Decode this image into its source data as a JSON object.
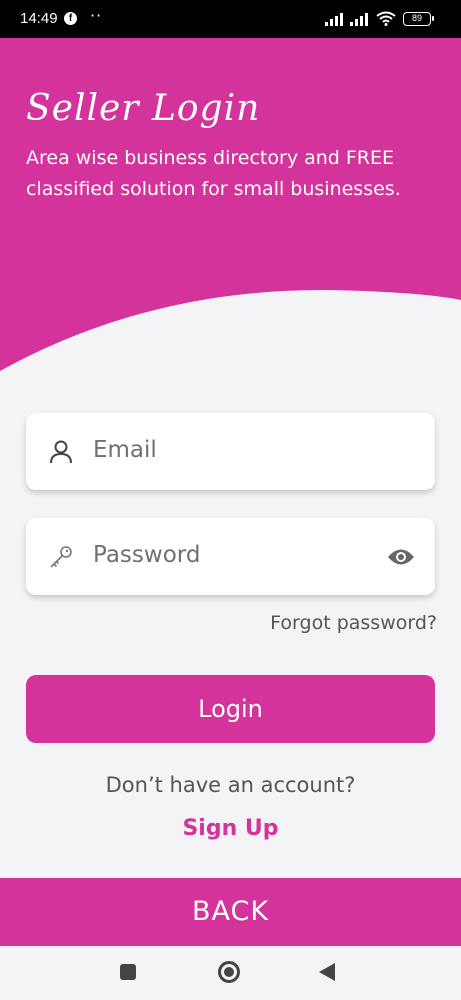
{
  "status": {
    "time": "14:49",
    "facebook_glyph": "f",
    "dots": "··",
    "battery": "89"
  },
  "header": {
    "title": "Seller Login",
    "subtitle": "Area wise business directory and FREE classified solution for small businesses."
  },
  "form": {
    "email_placeholder": "Email",
    "password_placeholder": "Password",
    "forgot_label": "Forgot password?",
    "login_label": "Login"
  },
  "footer": {
    "no_account_text": "Don’t have an account?",
    "signup_label": "Sign Up",
    "back_label": "BACK"
  },
  "icons": {
    "email": "user-icon",
    "password": "key-icon",
    "toggle_visibility": "eye-icon"
  },
  "colors": {
    "accent": "#d4339b",
    "background": "#f4f3f6"
  }
}
